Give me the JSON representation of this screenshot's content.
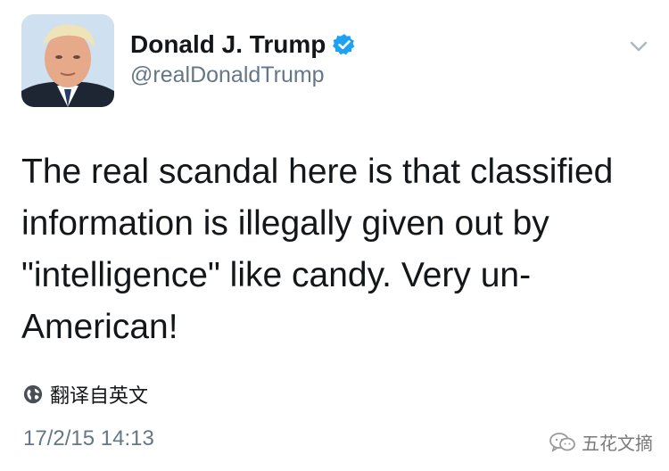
{
  "author": {
    "name": "Donald J. Trump",
    "handle": "@realDonaldTrump",
    "verified": true
  },
  "tweet": {
    "text": "The real scandal here is that classified information is illegally given out by \"intelligence\" like candy. Very un-American!",
    "translate_label": "翻译自英文",
    "timestamp": "17/2/15 14:13"
  },
  "watermark": {
    "text": "五花文摘"
  },
  "icons": {
    "verified": "verified-badge-icon",
    "menu": "chevron-down-icon",
    "translate": "globe-icon",
    "watermark": "wechat-icon"
  },
  "colors": {
    "verified_blue": "#1da1f2",
    "text_primary": "#14171a",
    "text_secondary": "#657786"
  }
}
